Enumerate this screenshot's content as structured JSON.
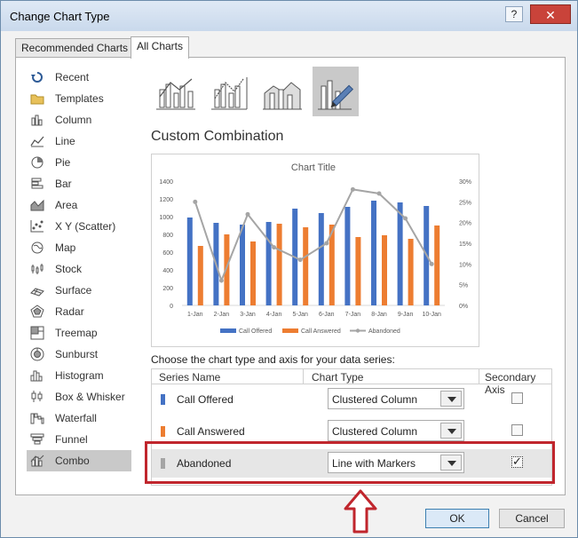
{
  "window": {
    "title": "Change Chart Type",
    "help_label": "?",
    "close_label": "✕"
  },
  "tabs": [
    {
      "label": "Recommended Charts",
      "active": false
    },
    {
      "label": "All Charts",
      "active": true
    }
  ],
  "sidebar": {
    "items": [
      {
        "label": "Recent",
        "icon": "recent-icon"
      },
      {
        "label": "Templates",
        "icon": "folder-icon"
      },
      {
        "label": "Column",
        "icon": "column-chart-icon"
      },
      {
        "label": "Line",
        "icon": "line-chart-icon"
      },
      {
        "label": "Pie",
        "icon": "pie-chart-icon"
      },
      {
        "label": "Bar",
        "icon": "bar-chart-icon"
      },
      {
        "label": "Area",
        "icon": "area-chart-icon"
      },
      {
        "label": "X Y (Scatter)",
        "icon": "scatter-chart-icon"
      },
      {
        "label": "Map",
        "icon": "map-chart-icon"
      },
      {
        "label": "Stock",
        "icon": "stock-chart-icon"
      },
      {
        "label": "Surface",
        "icon": "surface-chart-icon"
      },
      {
        "label": "Radar",
        "icon": "radar-chart-icon"
      },
      {
        "label": "Treemap",
        "icon": "treemap-chart-icon"
      },
      {
        "label": "Sunburst",
        "icon": "sunburst-chart-icon"
      },
      {
        "label": "Histogram",
        "icon": "histogram-chart-icon"
      },
      {
        "label": "Box & Whisker",
        "icon": "box-whisker-chart-icon"
      },
      {
        "label": "Waterfall",
        "icon": "waterfall-chart-icon"
      },
      {
        "label": "Funnel",
        "icon": "funnel-chart-icon"
      },
      {
        "label": "Combo",
        "icon": "combo-chart-icon",
        "selected": true
      }
    ]
  },
  "gallery": {
    "items": [
      {
        "icon": "clustered-column-line-icon"
      },
      {
        "icon": "clustered-column-line-secondary-axis-icon"
      },
      {
        "icon": "stacked-area-clustered-column-icon"
      },
      {
        "icon": "custom-combination-icon",
        "selected": true
      }
    ]
  },
  "section_title": "Custom Combination",
  "chart_data": {
    "type": "bar",
    "title": "Chart Title",
    "categories": [
      "1-Jan",
      "2-Jan",
      "3-Jan",
      "4-Jan",
      "5-Jan",
      "6-Jan",
      "7-Jan",
      "8-Jan",
      "9-Jan",
      "10-Jan"
    ],
    "series": [
      {
        "name": "Call Offered",
        "type": "bar",
        "axis": "primary",
        "color": "#4472c4",
        "values": [
          990,
          930,
          910,
          940,
          1090,
          1040,
          1110,
          1180,
          1160,
          1120
        ]
      },
      {
        "name": "Call Answered",
        "type": "bar",
        "axis": "primary",
        "color": "#ed7d31",
        "values": [
          670,
          800,
          720,
          920,
          880,
          910,
          770,
          790,
          750,
          900
        ]
      },
      {
        "name": "Abandoned",
        "type": "line",
        "axis": "secondary",
        "color": "#a5a5a5",
        "values": [
          0.25,
          0.06,
          0.22,
          0.14,
          0.11,
          0.15,
          0.28,
          0.27,
          0.21,
          0.1
        ]
      }
    ],
    "ylim": [
      0,
      1400
    ],
    "yticks": [
      "0",
      "200",
      "400",
      "600",
      "800",
      "1000",
      "1200",
      "1400"
    ],
    "y2lim": [
      0,
      0.3
    ],
    "y2ticks": [
      "0%",
      "5%",
      "10%",
      "15%",
      "20%",
      "25%",
      "30%"
    ],
    "legend": "bottom",
    "grid": false
  },
  "series_table": {
    "caption": "Choose the chart type and axis for your data series:",
    "headers": {
      "name": "Series Name",
      "type": "Chart Type",
      "axis": "Secondary Axis"
    },
    "rows": [
      {
        "name": "Call Offered",
        "color": "#4472c4",
        "chart_type": "Clustered Column",
        "secondary": false
      },
      {
        "name": "Call Answered",
        "color": "#ed7d31",
        "chart_type": "Clustered Column",
        "secondary": false
      },
      {
        "name": "Abandoned",
        "color": "#a5a5a5",
        "chart_type": "Line with Markers",
        "secondary": true,
        "highlighted": true
      }
    ]
  },
  "annotation": {
    "color": "#c0262d"
  },
  "footer": {
    "ok_label": "OK",
    "cancel_label": "Cancel"
  }
}
